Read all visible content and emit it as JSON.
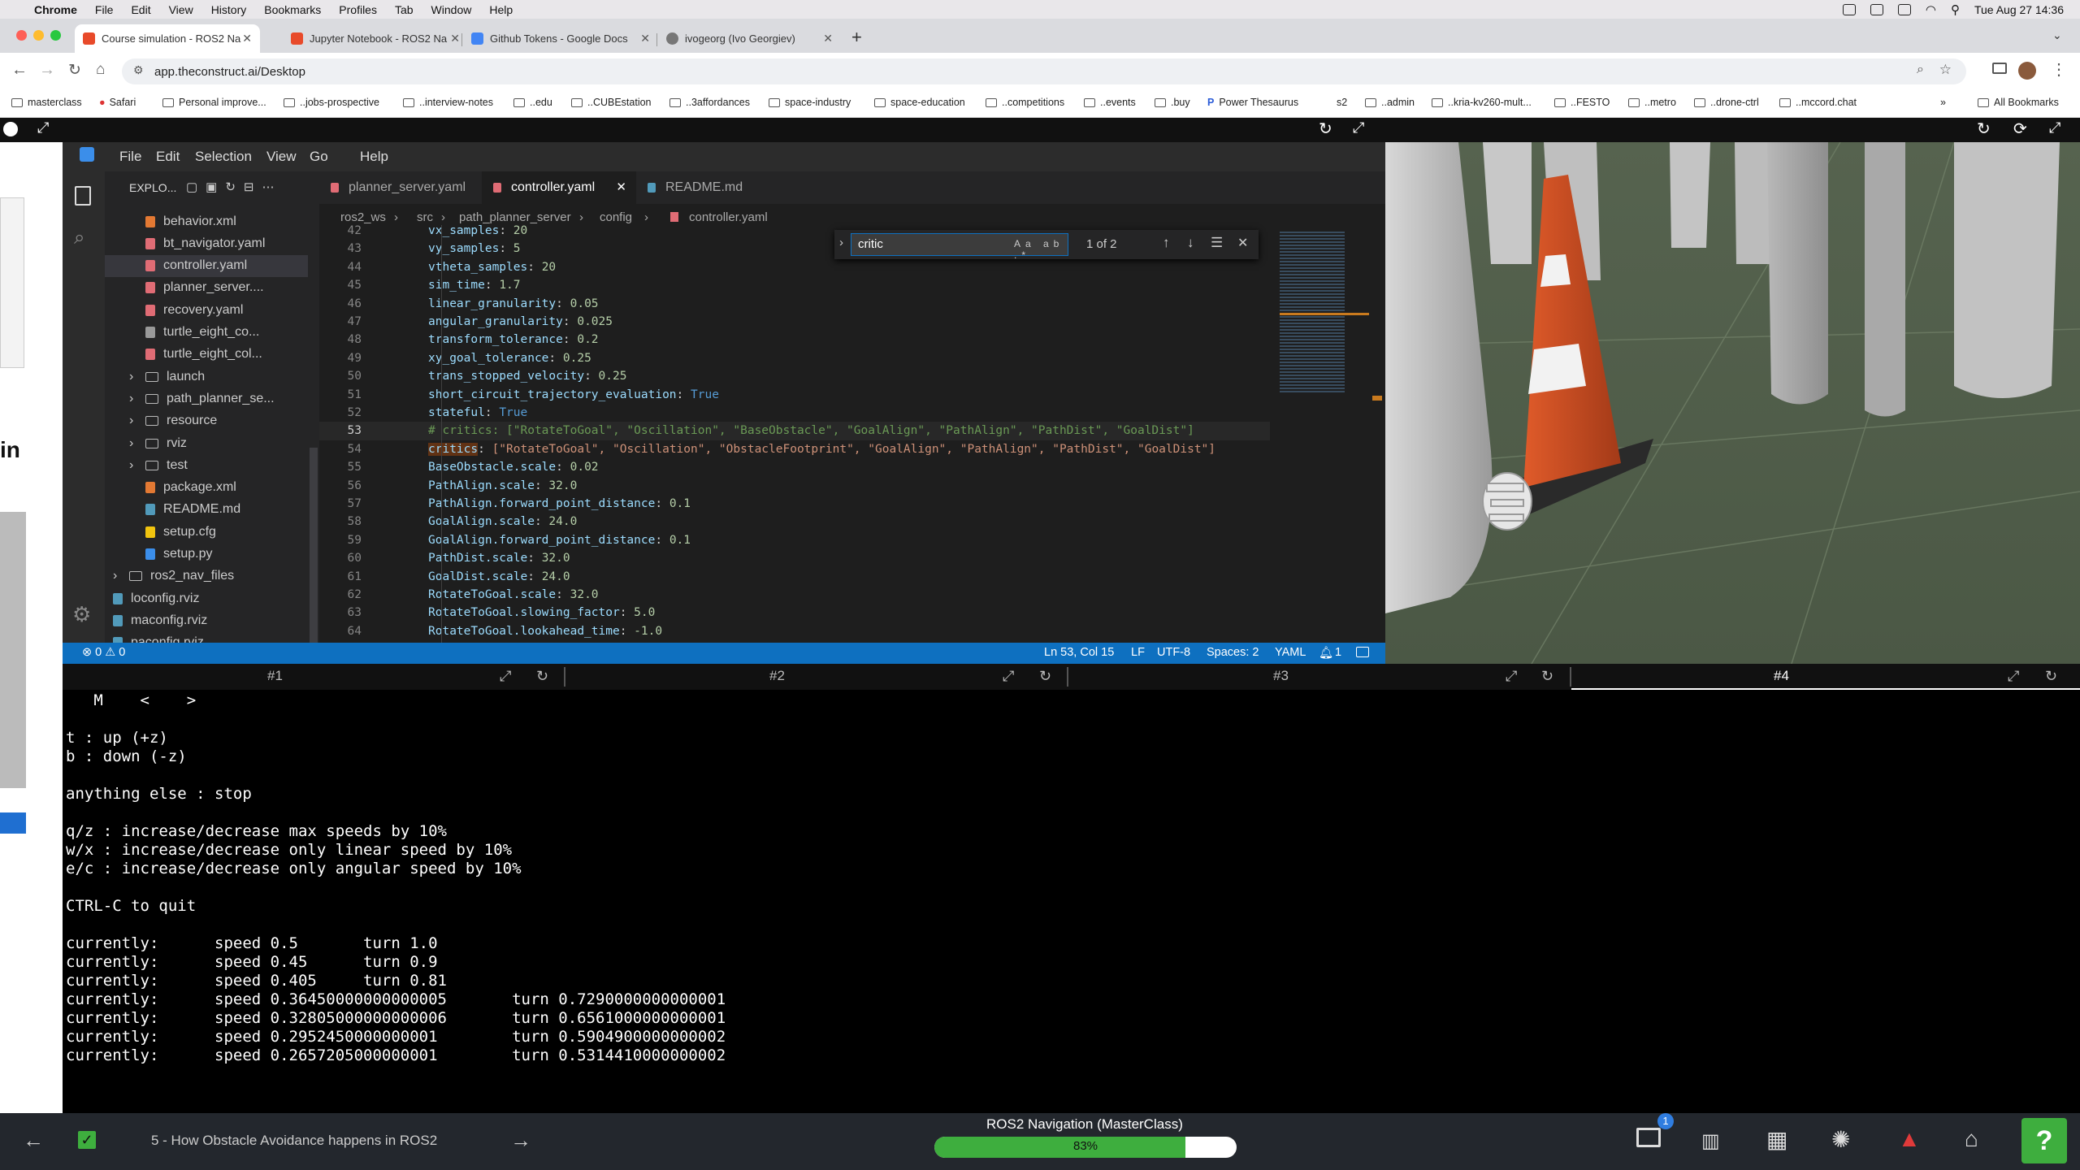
{
  "macos": {
    "menu": [
      "Chrome",
      "File",
      "Edit",
      "View",
      "History",
      "Bookmarks",
      "Profiles",
      "Tab",
      "Window",
      "Help"
    ],
    "clock": "Tue Aug 27  14:36"
  },
  "browser": {
    "tabs": [
      {
        "title": "Course simulation - ROS2 Na",
        "active": true,
        "color": "#e84a2a"
      },
      {
        "title": "Jupyter Notebook - ROS2 Na",
        "active": false,
        "color": "#e84a2a"
      },
      {
        "title": "Github Tokens - Google Docs",
        "active": false,
        "color": "#4285f4"
      },
      {
        "title": "ivogeorg (Ivo Georgiev)",
        "active": false,
        "color": "#777777"
      }
    ],
    "url": "app.theconstruct.ai/Desktop",
    "bookmarks": [
      "masterclass",
      "Safari",
      "Personal improve...",
      "..jobs-prospective",
      "..interview-notes",
      "..edu",
      "..CUBEstation",
      "..3affordances",
      "space-industry",
      "space-education",
      "..competitions",
      "..events",
      ".buy",
      "Power Thesaurus",
      "s2",
      "..admin",
      "..kria-kv260-mult...",
      "..FESTO",
      "..metro",
      "..drone-ctrl",
      "..mccord.chat"
    ],
    "all_bookmarks": "All Bookmarks"
  },
  "vscode": {
    "menu": [
      "File",
      "Edit",
      "Selection",
      "View",
      "Go",
      "Help"
    ],
    "explorer_title": "EXPLO...",
    "tree": [
      {
        "label": "behavior.xml",
        "indent": 3,
        "type": "xml"
      },
      {
        "label": "bt_navigator.yaml",
        "indent": 3,
        "type": "yaml"
      },
      {
        "label": "controller.yaml",
        "indent": 3,
        "type": "yaml",
        "selected": true
      },
      {
        "label": "planner_server....",
        "indent": 3,
        "type": "yaml"
      },
      {
        "label": "recovery.yaml",
        "indent": 3,
        "type": "yaml"
      },
      {
        "label": "turtle_eight_co...",
        "indent": 3,
        "type": "file"
      },
      {
        "label": "turtle_eight_col...",
        "indent": 3,
        "type": "yaml"
      },
      {
        "label": "launch",
        "indent": 2,
        "type": "folder"
      },
      {
        "label": "path_planner_se...",
        "indent": 2,
        "type": "folder"
      },
      {
        "label": "resource",
        "indent": 2,
        "type": "folder"
      },
      {
        "label": "rviz",
        "indent": 2,
        "type": "folder"
      },
      {
        "label": "test",
        "indent": 2,
        "type": "folder"
      },
      {
        "label": "package.xml",
        "indent": 2,
        "type": "xml"
      },
      {
        "label": "README.md",
        "indent": 2,
        "type": "md"
      },
      {
        "label": "setup.cfg",
        "indent": 2,
        "type": "cfg"
      },
      {
        "label": "setup.py",
        "indent": 2,
        "type": "py"
      },
      {
        "label": "ros2_nav_files",
        "indent": 1,
        "type": "folder"
      },
      {
        "label": "loconfig.rviz",
        "indent": 1,
        "type": "rviz"
      },
      {
        "label": "maconfig.rviz",
        "indent": 1,
        "type": "rviz"
      },
      {
        "label": "paconfig.rviz",
        "indent": 1,
        "type": "rviz"
      }
    ],
    "editor_tabs": [
      {
        "label": "planner_server.yaml",
        "active": false
      },
      {
        "label": "controller.yaml",
        "active": true
      },
      {
        "label": "README.md",
        "active": false
      }
    ],
    "breadcrumb": [
      "ros2_ws",
      "src",
      "path_planner_server",
      "config",
      "controller.yaml"
    ],
    "find": {
      "query": "critic",
      "result": "1 of 2"
    },
    "lines": [
      {
        "n": "42",
        "key": "vx_samples",
        "val": "20",
        "vt": "n"
      },
      {
        "n": "43",
        "key": "vy_samples",
        "val": "5",
        "vt": "n"
      },
      {
        "n": "44",
        "key": "vtheta_samples",
        "val": "20",
        "vt": "n"
      },
      {
        "n": "45",
        "key": "sim_time",
        "val": "1.7",
        "vt": "n"
      },
      {
        "n": "46",
        "key": "linear_granularity",
        "val": "0.05",
        "vt": "n"
      },
      {
        "n": "47",
        "key": "angular_granularity",
        "val": "0.025",
        "vt": "n"
      },
      {
        "n": "48",
        "key": "transform_tolerance",
        "val": "0.2",
        "vt": "n"
      },
      {
        "n": "49",
        "key": "xy_goal_tolerance",
        "val": "0.25",
        "vt": "n"
      },
      {
        "n": "50",
        "key": "trans_stopped_velocity",
        "val": "0.25",
        "vt": "n"
      },
      {
        "n": "51",
        "key": "short_circuit_trajectory_evaluation",
        "val": "True",
        "vt": "b"
      },
      {
        "n": "52",
        "key": "stateful",
        "val": "True",
        "vt": "b"
      },
      {
        "n": "53",
        "comment": "# critics: [\"RotateToGoal\", \"Oscillation\", \"BaseObstacle\", \"GoalAlign\", \"PathAlign\", \"PathDist\", \"GoalDist\"]"
      },
      {
        "n": "54",
        "key": "critics",
        "val": "[\"RotateToGoal\", \"Oscillation\", \"ObstacleFootprint\", \"GoalAlign\", \"PathAlign\", \"PathDist\", \"GoalDist\"]",
        "vt": "s"
      },
      {
        "n": "55",
        "key": "BaseObstacle.scale",
        "val": "0.02",
        "vt": "n"
      },
      {
        "n": "56",
        "key": "PathAlign.scale",
        "val": "32.0",
        "vt": "n"
      },
      {
        "n": "57",
        "key": "PathAlign.forward_point_distance",
        "val": "0.1",
        "vt": "n"
      },
      {
        "n": "58",
        "key": "GoalAlign.scale",
        "val": "24.0",
        "vt": "n"
      },
      {
        "n": "59",
        "key": "GoalAlign.forward_point_distance",
        "val": "0.1",
        "vt": "n"
      },
      {
        "n": "60",
        "key": "PathDist.scale",
        "val": "32.0",
        "vt": "n"
      },
      {
        "n": "61",
        "key": "GoalDist.scale",
        "val": "24.0",
        "vt": "n"
      },
      {
        "n": "62",
        "key": "RotateToGoal.scale",
        "val": "32.0",
        "vt": "n"
      },
      {
        "n": "63",
        "key": "RotateToGoal.slowing_factor",
        "val": "5.0",
        "vt": "n"
      },
      {
        "n": "64",
        "key": "RotateToGoal.lookahead_time",
        "val": "-1.0",
        "vt": "n"
      }
    ],
    "status": {
      "problems": "⊗ 0 ⚠ 0",
      "position": "Ln 53, Col 15",
      "eol": "LF",
      "encoding": "UTF-8",
      "spaces": "Spaces: 2",
      "language": "YAML",
      "notifications": "1"
    }
  },
  "term_tabs": [
    "#1",
    "#2",
    "#3",
    "#4"
  ],
  "terminal": [
    "   M    <    >",
    "",
    "t : up (+z)",
    "b : down (-z)",
    "",
    "anything else : stop",
    "",
    "q/z : increase/decrease max speeds by 10%",
    "w/x : increase/decrease only linear speed by 10%",
    "e/c : increase/decrease only angular speed by 10%",
    "",
    "CTRL-C to quit",
    "",
    "currently:      speed 0.5       turn 1.0",
    "currently:      speed 0.45      turn 0.9",
    "currently:      speed 0.405     turn 0.81",
    "currently:      speed 0.36450000000000005       turn 0.7290000000000001",
    "currently:      speed 0.32805000000000006       turn 0.6561000000000001",
    "currently:      speed 0.2952450000000001        turn 0.5904900000000002",
    "currently:      speed 0.2657205000000001        turn 0.5314410000000002"
  ],
  "bottom": {
    "lesson": "5 - How Obstacle Avoidance happens in ROS2",
    "course": "ROS2 Navigation (MasterClass)",
    "progress_pct": 83,
    "progress_label": "83%",
    "notification_count": "1"
  },
  "left_pane_text": "in",
  "colors": {
    "accent": "#0e70c0",
    "progress": "#3eae3e",
    "help": "#3eae3e"
  }
}
